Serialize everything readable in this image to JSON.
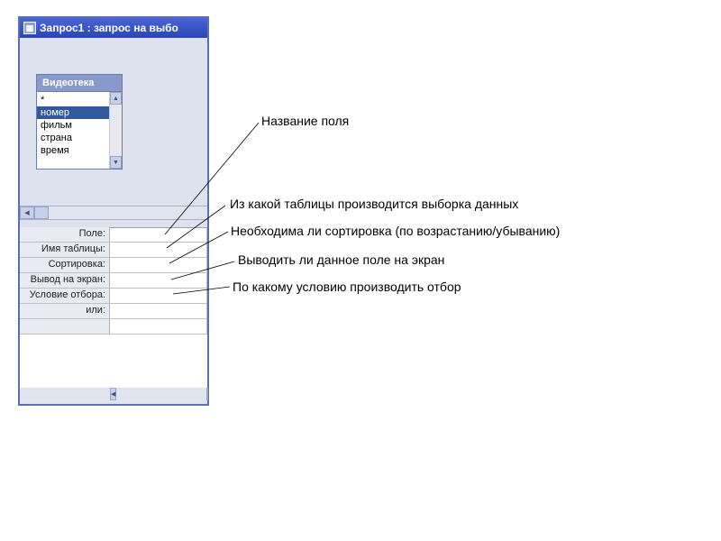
{
  "window": {
    "title": "Запрос1 : запрос на выбо"
  },
  "table": {
    "header": "Видеотека",
    "items": [
      "*",
      "номер",
      "фильм",
      "страна",
      "время"
    ],
    "selected_index": 1
  },
  "grid": {
    "rows": [
      "Поле:",
      "Имя таблицы:",
      "Сортировка:",
      "Вывод на экран:",
      "Условие отбора:",
      "или:"
    ]
  },
  "annotations": {
    "a1": "Название поля",
    "a2": "Из какой таблицы производится выборка данных",
    "a3": "Необходима ли сортировка (по возрастанию/убыванию)",
    "a4": "Выводить ли данное поле на экран",
    "a5": "По какому условию производить отбор"
  }
}
